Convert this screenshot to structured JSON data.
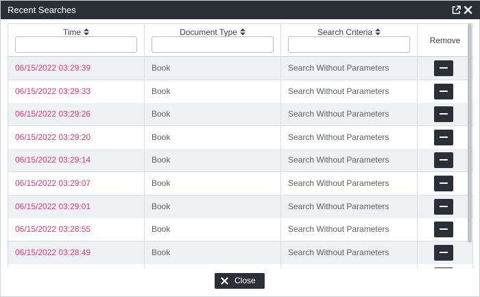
{
  "window": {
    "title": "Recent Searches"
  },
  "table": {
    "columns": [
      {
        "label": "Time",
        "filter_value": ""
      },
      {
        "label": "Document Type",
        "filter_value": ""
      },
      {
        "label": "Search Criteria",
        "filter_value": ""
      },
      {
        "label": "Remove"
      }
    ],
    "rows": [
      {
        "time": "06/15/2022 03:29:39",
        "document_type": "Book",
        "search_criteria": "Search Without Parameters"
      },
      {
        "time": "06/15/2022 03:29:33",
        "document_type": "Book",
        "search_criteria": "Search Without Parameters"
      },
      {
        "time": "06/15/2022 03:29:26",
        "document_type": "Book",
        "search_criteria": "Search Without Parameters"
      },
      {
        "time": "06/15/2022 03:29:20",
        "document_type": "Book",
        "search_criteria": "Search Without Parameters"
      },
      {
        "time": "06/15/2022 03:29:14",
        "document_type": "Book",
        "search_criteria": "Search Without Parameters"
      },
      {
        "time": "06/15/2022 03:29:07",
        "document_type": "Book",
        "search_criteria": "Search Without Parameters"
      },
      {
        "time": "06/15/2022 03:29:01",
        "document_type": "Book",
        "search_criteria": "Search Without Parameters"
      },
      {
        "time": "06/15/2022 03:28:55",
        "document_type": "Book",
        "search_criteria": "Search Without Parameters"
      },
      {
        "time": "06/15/2022 03:28:49",
        "document_type": "Book",
        "search_criteria": "Search Without Parameters"
      }
    ]
  },
  "footer": {
    "close_label": "Close"
  },
  "colors": {
    "titlebar": "#2b3038",
    "link": "#e0357d",
    "stripe": "#eef1f4",
    "button": "#2b3038"
  }
}
